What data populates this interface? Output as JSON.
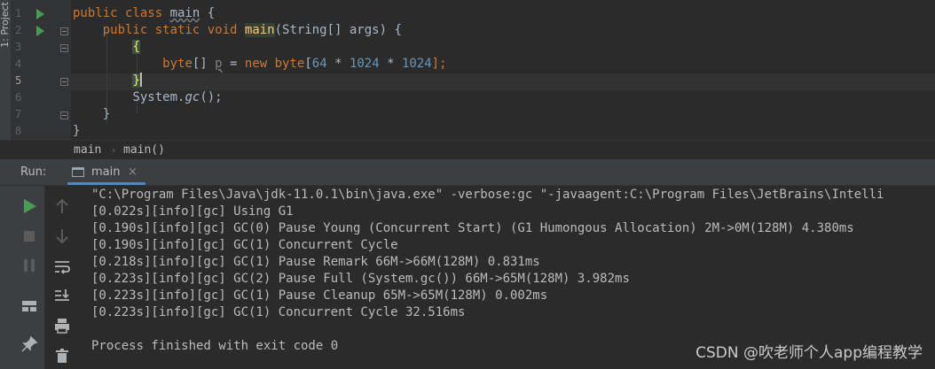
{
  "sidebar": {
    "project_label": "1: Project"
  },
  "editor": {
    "line_numbers": [
      "1",
      "2",
      "3",
      "4",
      "5",
      "6",
      "7",
      "8"
    ],
    "current_line": "5",
    "code": {
      "l1_kw": "public class ",
      "l1_name": "main",
      "l1_rest": " {",
      "l2_indent": "    ",
      "l2_kw": "public static void ",
      "l2_name": "main",
      "l2_rest": "(String[] args) {",
      "l3_indent": "        ",
      "l3_brace": "{",
      "l4_indent": "            ",
      "l4_type": "byte",
      "l4_a": "[] ",
      "l4_var": "p",
      "l4_b": " = ",
      "l4_new": "new ",
      "l4_type2": "byte",
      "l4_c": "[",
      "l4_n1": "64",
      "l4_d": " * ",
      "l4_n2": "1024",
      "l4_e": " * ",
      "l4_n3": "1024",
      "l4_f": "];",
      "l5_indent": "        ",
      "l5_brace": "}",
      "l6_indent": "        ",
      "l6_a": "System.",
      "l6_method": "gc",
      "l6_b": "();",
      "l7_indent": "    ",
      "l7_brace": "}",
      "l8_brace": "}"
    }
  },
  "breadcrumb": {
    "item1": "main",
    "separator": "›",
    "item2": "main()"
  },
  "run_panel": {
    "label": "Run:",
    "tab_label": "main",
    "close_glyph": "×",
    "console_lines": [
      "\"C:\\Program Files\\Java\\jdk-11.0.1\\bin\\java.exe\" -verbose:gc \"-javaagent:C:\\Program Files\\JetBrains\\Intelli",
      "[0.022s][info][gc] Using G1",
      "[0.190s][info][gc] GC(0) Pause Young (Concurrent Start) (G1 Humongous Allocation) 2M->0M(128M) 4.380ms",
      "[0.190s][info][gc] GC(1) Concurrent Cycle",
      "[0.218s][info][gc] GC(1) Pause Remark 66M->66M(128M) 0.831ms",
      "[0.223s][info][gc] GC(2) Pause Full (System.gc()) 66M->65M(128M) 3.982ms",
      "[0.223s][info][gc] GC(1) Pause Cleanup 65M->65M(128M) 0.002ms",
      "[0.223s][info][gc] GC(1) Concurrent Cycle 32.516ms",
      "",
      "Process finished with exit code 0"
    ],
    "toolbar_icons": [
      "rerun-icon",
      "stop-icon",
      "pause-icon",
      "layout-icon",
      "pin-icon",
      "scroll-up-icon",
      "scroll-down-icon",
      "soft-wrap-icon",
      "scroll-to-end-icon",
      "print-icon",
      "trash-icon"
    ]
  },
  "watermark": "CSDN @吹老师个人app编程教学",
  "colors": {
    "keyword": "#cc7832",
    "number": "#6897bb",
    "text": "#a9b7c6",
    "run_green": "#499c54",
    "tab_underline": "#4a88c7"
  }
}
